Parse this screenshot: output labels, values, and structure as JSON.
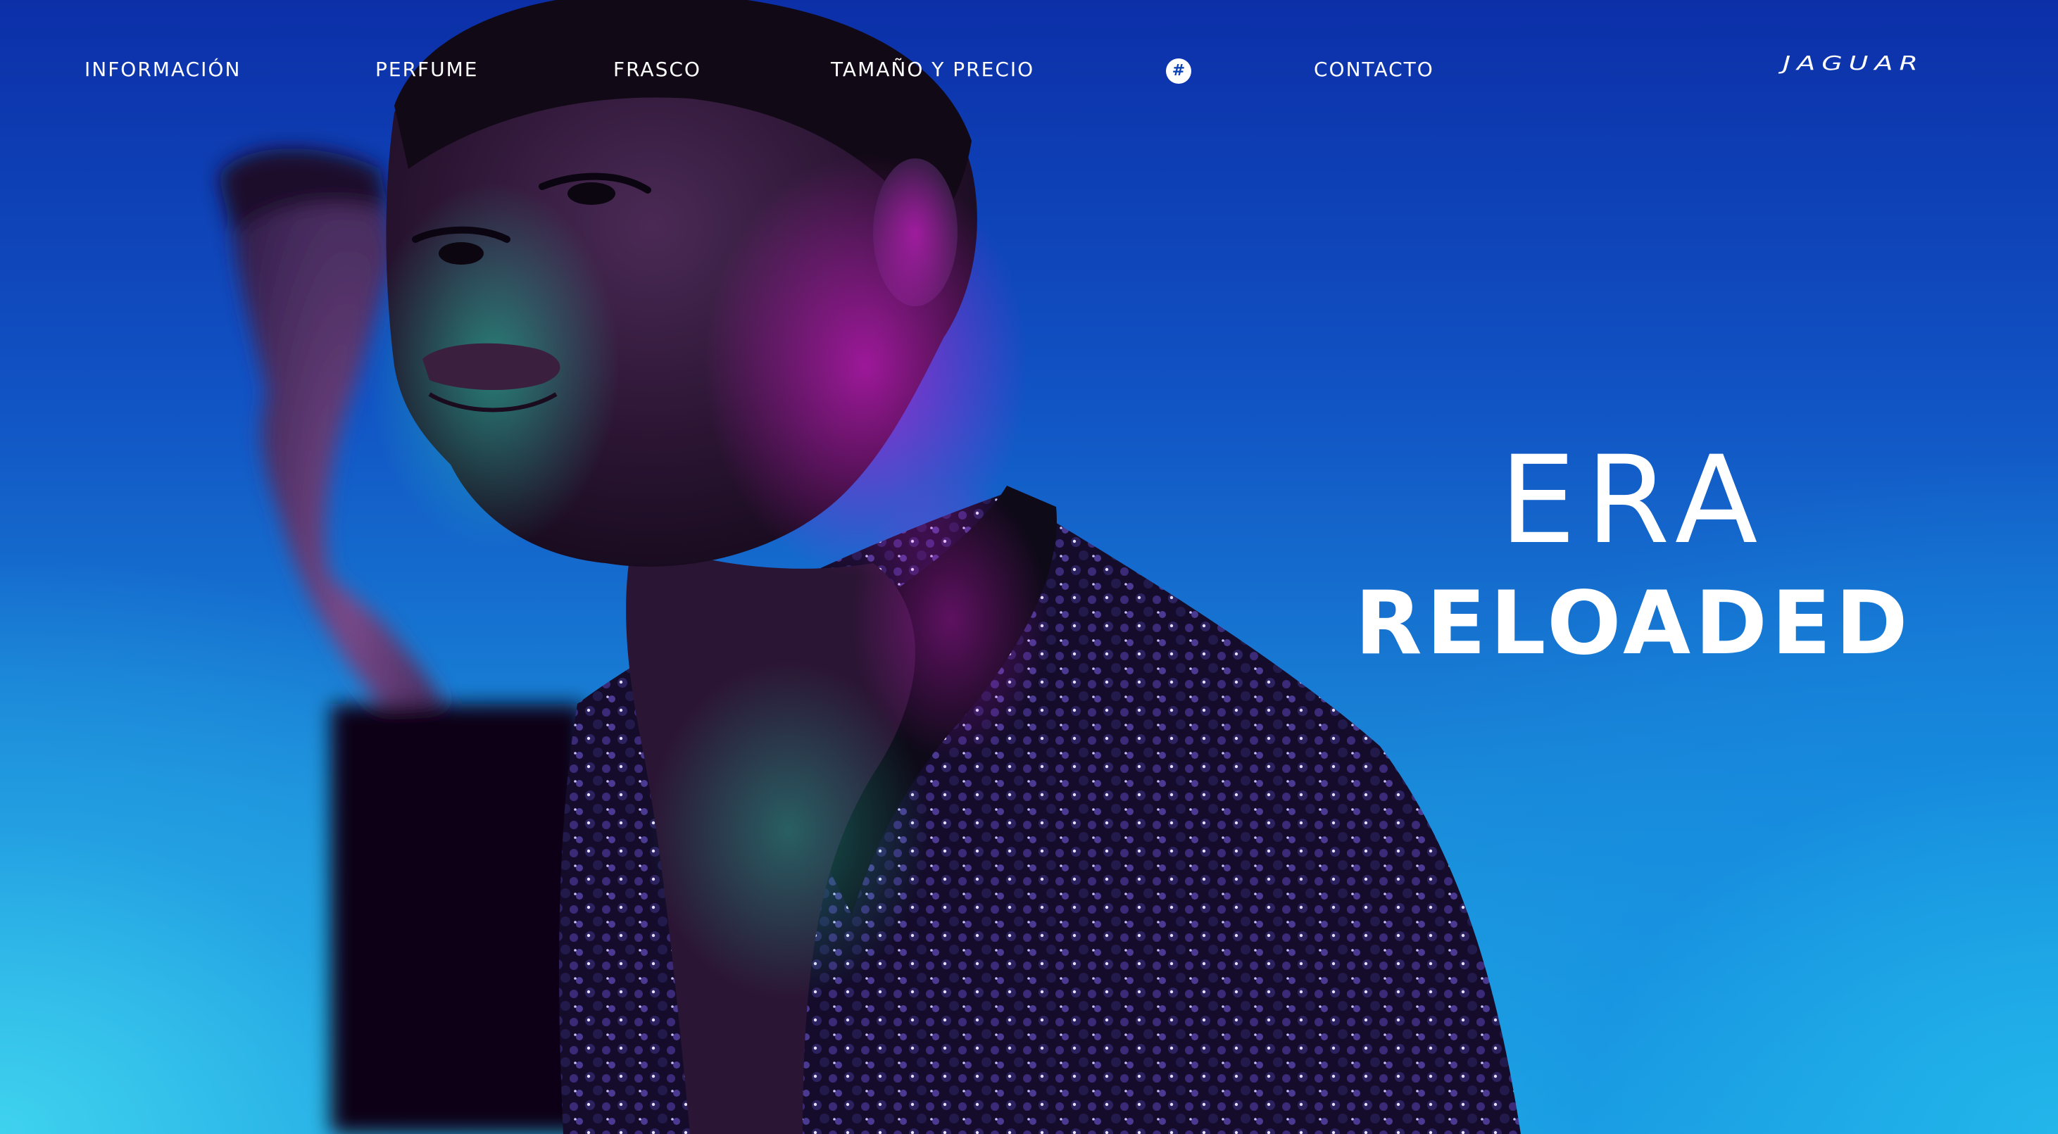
{
  "nav": {
    "items": [
      {
        "label": "INFORMACIÓN"
      },
      {
        "label": "PERFUME"
      },
      {
        "label": "FRASCO"
      },
      {
        "label": "TAMAÑO Y PRECIO"
      },
      {
        "label": "CONTACTO"
      }
    ],
    "hash_symbol": "#",
    "hash_icon": "hashtag-icon"
  },
  "brand": {
    "logo_text": "JAGUAR"
  },
  "hero": {
    "headline_line1": "ERA",
    "headline_line2": "RELOADED",
    "image": "two-male-models-neon-lit-sequin-jacket"
  },
  "colors": {
    "background_top": "#0c2fa8",
    "background_bottom": "#22b2e6",
    "text": "#ffffff",
    "accent_magenta": "#d21ccf",
    "accent_teal": "#2ad8b4"
  }
}
